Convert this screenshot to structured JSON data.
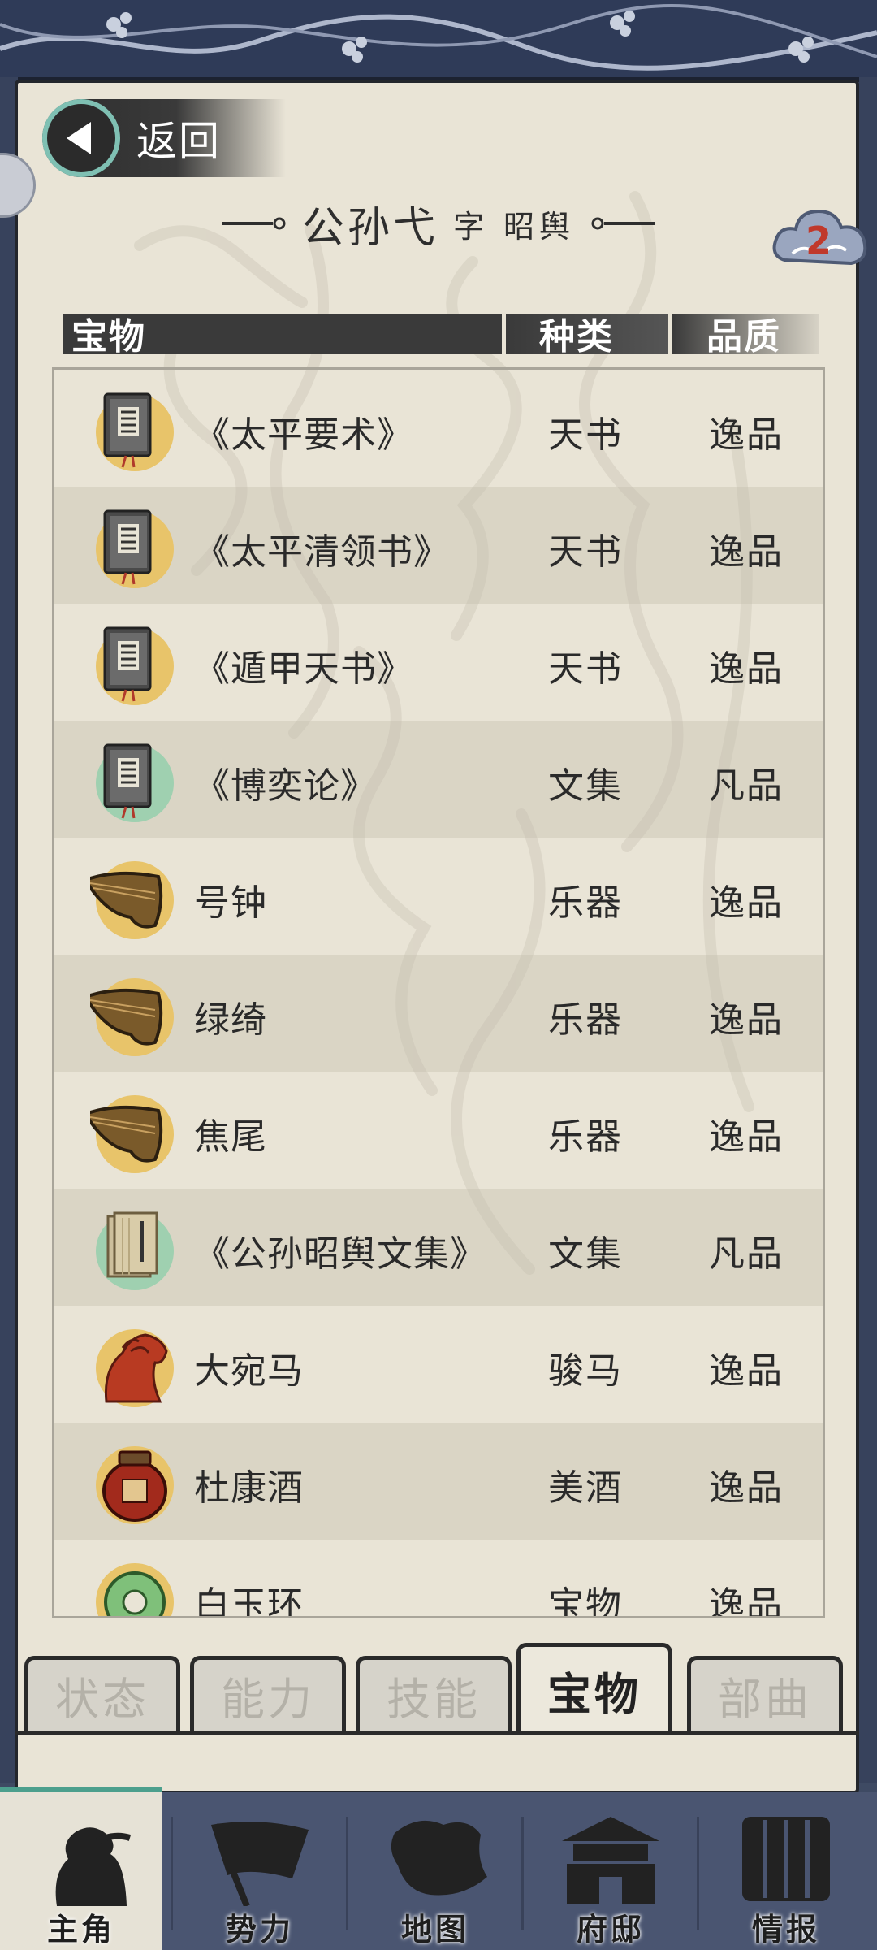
{
  "header": {
    "back_label": "返回",
    "title_name": "公孙弋",
    "title_courtesy": "字 昭舆",
    "badge_count": "2"
  },
  "columns": {
    "item": "宝物",
    "kind": "种类",
    "quality": "品质"
  },
  "items": [
    {
      "name": "《太平要术》",
      "kind": "天书",
      "quality": "逸品",
      "icon": "book-icon",
      "bg": "#e8c46a"
    },
    {
      "name": "《太平清领书》",
      "kind": "天书",
      "quality": "逸品",
      "icon": "book-icon",
      "bg": "#e8c46a"
    },
    {
      "name": "《遁甲天书》",
      "kind": "天书",
      "quality": "逸品",
      "icon": "book-icon",
      "bg": "#e8c46a"
    },
    {
      "name": "《博奕论》",
      "kind": "文集",
      "quality": "凡品",
      "icon": "book-icon",
      "bg": "#9fd0b0"
    },
    {
      "name": "号钟",
      "kind": "乐器",
      "quality": "逸品",
      "icon": "zither-icon",
      "bg": "#e8c46a"
    },
    {
      "name": "绿绮",
      "kind": "乐器",
      "quality": "逸品",
      "icon": "zither-icon",
      "bg": "#e8c46a"
    },
    {
      "name": "焦尾",
      "kind": "乐器",
      "quality": "逸品",
      "icon": "zither-icon",
      "bg": "#e8c46a"
    },
    {
      "name": "《公孙昭舆文集》",
      "kind": "文集",
      "quality": "凡品",
      "icon": "scroll-book-icon",
      "bg": "#9fd0b0"
    },
    {
      "name": "大宛马",
      "kind": "骏马",
      "quality": "逸品",
      "icon": "horse-icon",
      "bg": "#e8c46a"
    },
    {
      "name": "杜康酒",
      "kind": "美酒",
      "quality": "逸品",
      "icon": "wine-jar-icon",
      "bg": "#e8c46a"
    },
    {
      "name": "白玉环",
      "kind": "宝物",
      "quality": "逸品",
      "icon": "jade-ring-icon",
      "bg": "#e8c46a"
    }
  ],
  "tabs": [
    {
      "label": "状态",
      "active": false
    },
    {
      "label": "能力",
      "active": false
    },
    {
      "label": "技能",
      "active": false
    },
    {
      "label": "宝物",
      "active": true
    },
    {
      "label": "部曲",
      "active": false
    }
  ],
  "nav": [
    {
      "label": "主角",
      "icon": "warrior-icon",
      "active": true
    },
    {
      "label": "势力",
      "icon": "flag-icon",
      "active": false
    },
    {
      "label": "地图",
      "icon": "map-icon",
      "active": false
    },
    {
      "label": "府邸",
      "icon": "mansion-icon",
      "active": false
    },
    {
      "label": "情报",
      "icon": "scroll-icon",
      "active": false
    }
  ],
  "colors": {
    "frame": "#3e4a63",
    "parchment": "#e9e4d6",
    "accent_teal": "#7fc0b3",
    "badge_red": "#c0392b"
  }
}
